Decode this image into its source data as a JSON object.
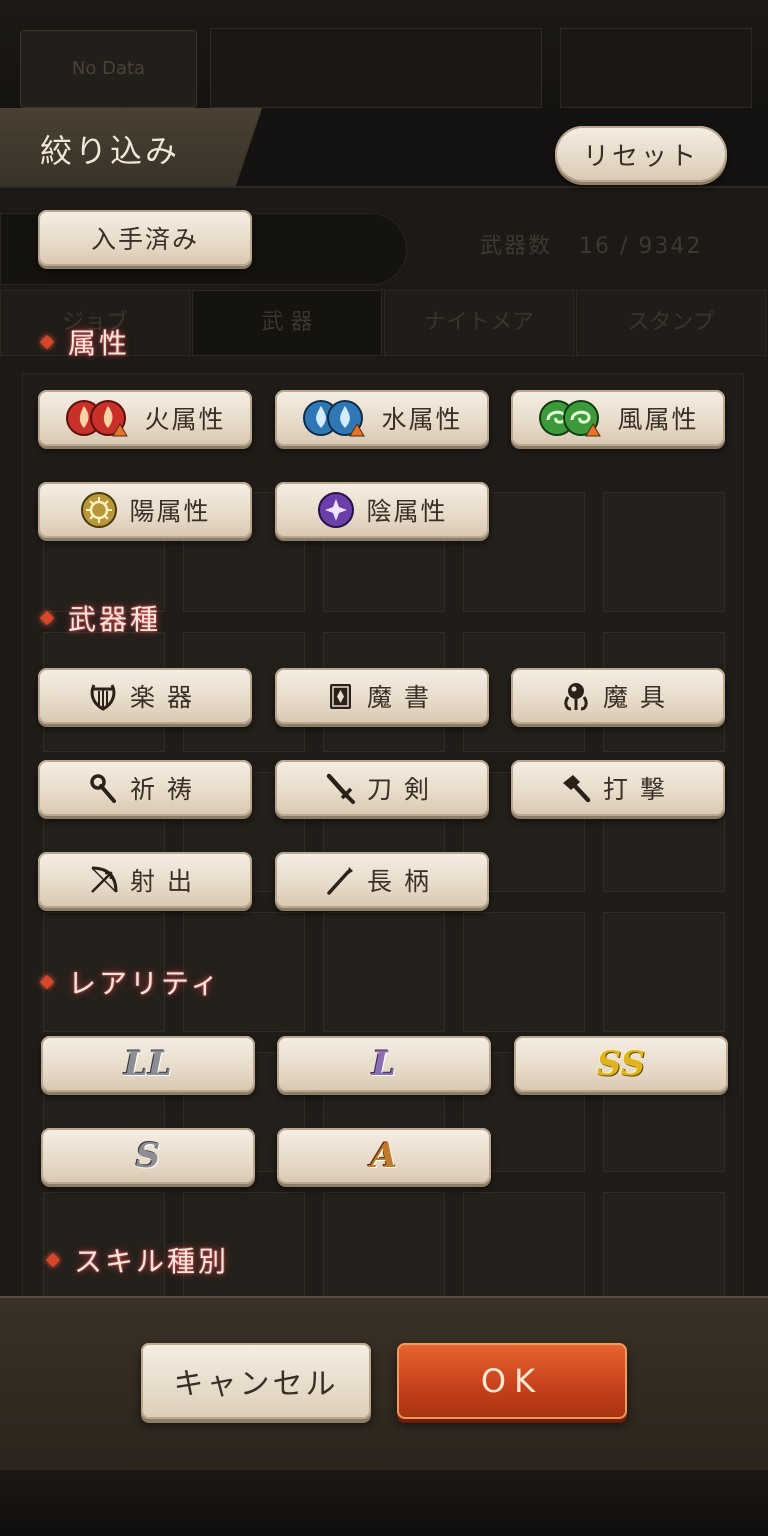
{
  "background": {
    "no_data_label": "No Data",
    "weapon_count_label": "武器数",
    "weapon_count_value": "16 / 9342",
    "tabs": [
      "ジョブ",
      "武 器",
      "ナイトメア",
      "スタンプ"
    ]
  },
  "header": {
    "title": "絞り込み",
    "reset_label": "リセット"
  },
  "owned_filter_label": "入手済み",
  "sections": {
    "attribute": "属性",
    "weapon_type": "武器種",
    "rarity": "レアリティ",
    "skill_type": "スキル種別"
  },
  "attributes": {
    "fire": {
      "label": "火属性",
      "icon": "fire-element-icon",
      "color": "#c9302a"
    },
    "water": {
      "label": "水属性",
      "icon": "water-element-icon",
      "color": "#2f78b5"
    },
    "wind": {
      "label": "風属性",
      "icon": "wind-element-icon",
      "color": "#3c9a3a"
    },
    "light": {
      "label": "陽属性",
      "icon": "sun-element-icon",
      "color": "#b8963a"
    },
    "dark": {
      "label": "陰属性",
      "icon": "moon-element-icon",
      "color": "#6b3fa8"
    }
  },
  "weapon_types": {
    "instrument": {
      "label": "楽器",
      "icon": "lyre-icon"
    },
    "tome": {
      "label": "魔書",
      "icon": "book-icon"
    },
    "artifact": {
      "label": "魔具",
      "icon": "orb-icon"
    },
    "prayer": {
      "label": "祈祷",
      "icon": "staff-icon"
    },
    "sword": {
      "label": "刀剣",
      "icon": "sword-icon"
    },
    "blunt": {
      "label": "打撃",
      "icon": "hammer-icon"
    },
    "ranged": {
      "label": "射出",
      "icon": "bow-icon"
    },
    "polearm": {
      "label": "長柄",
      "icon": "spear-icon"
    }
  },
  "rarities": {
    "ll": {
      "label": "LL",
      "color": "#8d8d94"
    },
    "l": {
      "label": "L",
      "color": "#8a6fb0"
    },
    "ss": {
      "label": "SS",
      "color": "#c99a18"
    },
    "s": {
      "label": "S",
      "color": "#8d8d94"
    },
    "a": {
      "label": "A",
      "color": "#c07a2a"
    }
  },
  "footer": {
    "cancel_label": "キャンセル",
    "ok_label": "OK"
  }
}
